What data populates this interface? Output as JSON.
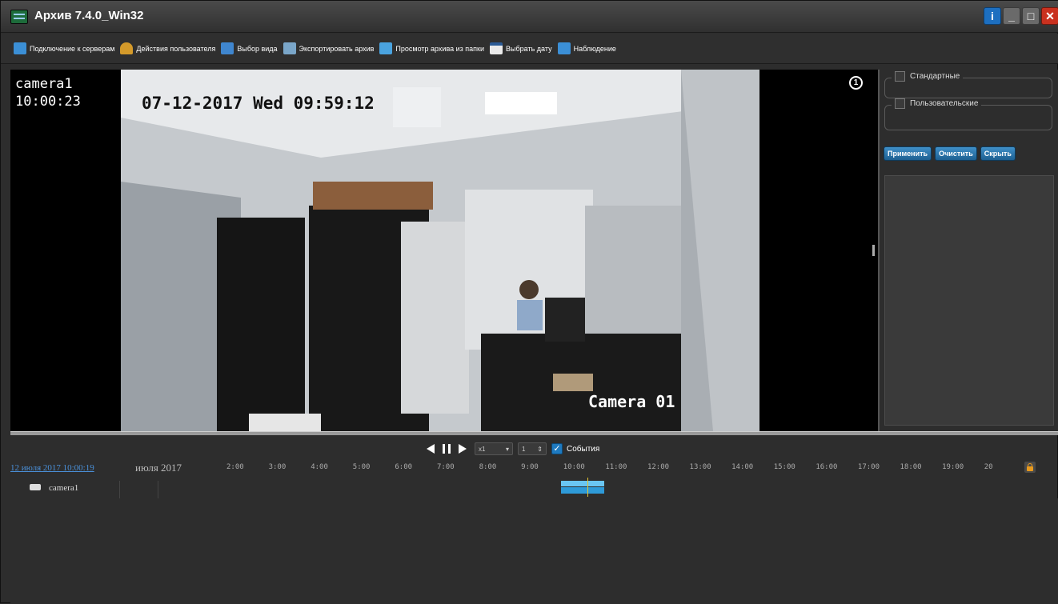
{
  "window": {
    "title": "Архив 7.4.0_Win32",
    "buttons": {
      "info": "i",
      "minimize": "_",
      "maximize": "□",
      "close": "✕"
    }
  },
  "toolbar": {
    "items": [
      {
        "label": "Подключение к серверам",
        "icon": "server-icon"
      },
      {
        "label": "Действия пользователя",
        "icon": "user-icon"
      },
      {
        "label": "Выбор вида",
        "icon": "layout-icon"
      },
      {
        "label": "Экспортировать архив",
        "icon": "export-icon"
      },
      {
        "label": "Просмотр архива из папки",
        "icon": "folder-icon"
      },
      {
        "label": "Выбрать дату",
        "icon": "calendar-icon"
      },
      {
        "label": "Наблюдение",
        "icon": "monitor-icon"
      }
    ]
  },
  "video": {
    "camera_name": "camera1",
    "camera_time": "10:00:23",
    "osd_datetime": "07-12-2017 Wed 09:59:12",
    "osd_camera": "Camera 01",
    "badge": "1"
  },
  "right_panel": {
    "group_standard": "Стандартные",
    "group_custom": "Пользовательские",
    "apply": "Применить",
    "clear": "Очистить",
    "hide": "Скрыть"
  },
  "playback": {
    "speed": "x1",
    "step": "1",
    "events_label": "События",
    "events_checked": true
  },
  "timeline": {
    "current": "12 июля 2017 10:00:19",
    "month": "июля 2017",
    "hours": [
      "2:00",
      "3:00",
      "4:00",
      "5:00",
      "6:00",
      "7:00",
      "8:00",
      "9:00",
      "10:00",
      "11:00",
      "12:00",
      "13:00",
      "14:00",
      "15:00",
      "16:00",
      "17:00",
      "18:00",
      "19:00",
      "20"
    ],
    "tracks": [
      {
        "name": "camera1"
      }
    ]
  },
  "colors": {
    "accent": "#1e7ac0",
    "record_light": "#6ac6f3",
    "record_dark": "#2e9ad8",
    "cursor": "#e5c532",
    "close": "#c9311f"
  }
}
